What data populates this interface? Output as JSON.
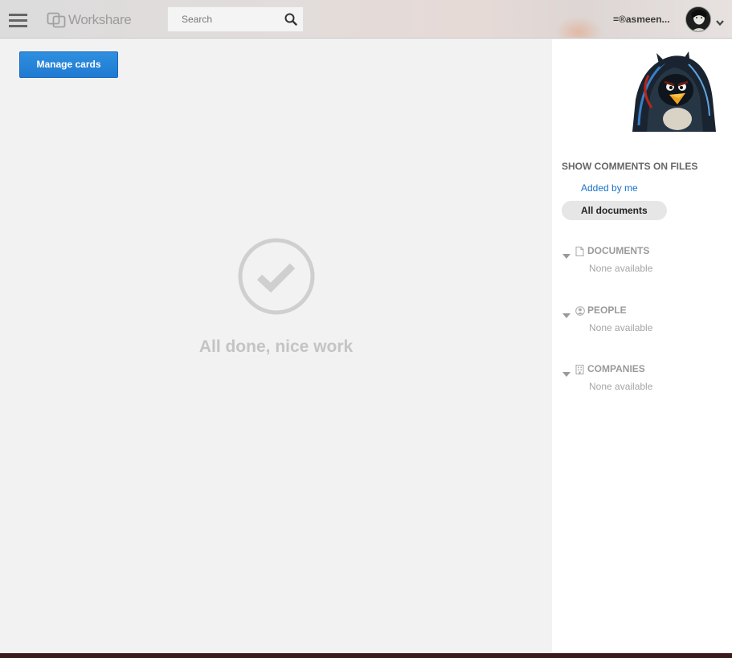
{
  "header": {
    "brand": "Workshare",
    "search_placeholder": "Search",
    "user_name": "=®asmeen..."
  },
  "main": {
    "manage_cards_label": "Manage cards",
    "empty_message": "All done, nice work"
  },
  "sidebar": {
    "section_title": "SHOW COMMENTS ON FILES",
    "filters": [
      "Added by me",
      "All documents"
    ],
    "active_filter": "All documents",
    "groups": [
      {
        "label": "DOCUMENTS",
        "icon": "document-icon",
        "empty": "None available"
      },
      {
        "label": "PEOPLE",
        "icon": "person-icon",
        "empty": "None available"
      },
      {
        "label": "COMPANIES",
        "icon": "building-icon",
        "empty": "None available"
      }
    ]
  },
  "colors": {
    "accent": "#1f7ad2",
    "link": "#1a73c8",
    "muted_text": "#9a9a9a"
  }
}
